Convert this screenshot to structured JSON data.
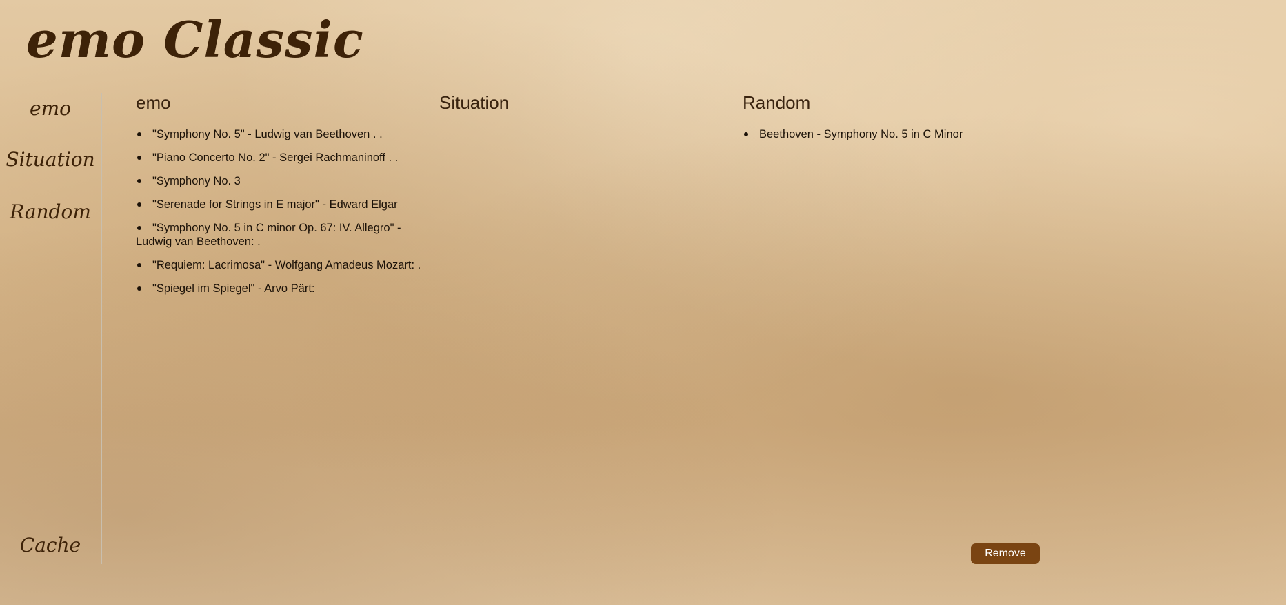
{
  "site": {
    "title": "emo Classic"
  },
  "nav": {
    "items": [
      {
        "label": "emo"
      },
      {
        "label": "Situation"
      },
      {
        "label": "Random"
      }
    ],
    "cache_label": "Cache"
  },
  "columns": {
    "emo": {
      "heading": "emo",
      "songs": [
        "\"Symphony No. 5\" - Ludwig van Beethoven . .",
        "\"Piano Concerto No. 2\" - Sergei Rachmaninoff . .",
        "\"Symphony No. 3",
        "\"Serenade for Strings in E major\" - Edward Elgar",
        "\"Symphony No. 5 in C minor Op. 67: IV. Allegro\" - Ludwig van Beethoven: .",
        "\"Requiem: Lacrimosa\" - Wolfgang Amadeus Mozart: .",
        "\"Spiegel im Spiegel\" - Arvo Pärt:"
      ]
    },
    "situation": {
      "heading": "Situation",
      "songs": []
    },
    "random": {
      "heading": "Random",
      "songs": [
        "Beethoven - Symphony No. 5 in C Minor"
      ]
    }
  },
  "actions": {
    "remove_label": "Remove"
  },
  "colors": {
    "accent": "#7a4412",
    "title_text": "#3d2208",
    "paper": "#d8b88c"
  }
}
